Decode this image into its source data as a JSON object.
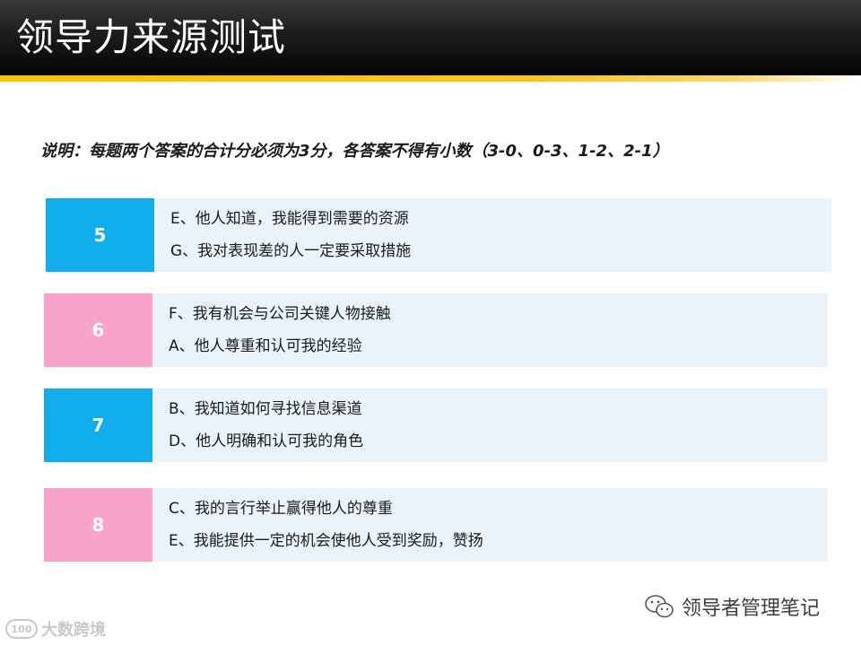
{
  "slide": {
    "title": "领导力来源测试",
    "instruction": "说明：每题两个答案的合计分必须为3分，各答案不得有小数（3-0、0-3、1-2、2-1）"
  },
  "colors": {
    "blue": "#10aeea",
    "pink": "#f9a3cb",
    "accent": "#f6c400",
    "row_background": "#eaf3fa"
  },
  "rows": [
    {
      "number": "5",
      "color": "blue",
      "lines": [
        "E、他人知道，我能得到需要的资源",
        "G、我对表现差的人一定要采取措施"
      ]
    },
    {
      "number": "6",
      "color": "pink",
      "lines": [
        "F、我有机会与公司关键人物接触",
        "A、他人尊重和认可我的经验"
      ]
    },
    {
      "number": "7",
      "color": "blue",
      "lines": [
        "B、我知道如何寻找信息渠道",
        "D、他人明确和认可我的角色"
      ]
    },
    {
      "number": "8",
      "color": "pink",
      "lines": [
        "C、我的言行举止赢得他人的尊重",
        "E、我能提供一定的机会使他人受到奖励，赞扬"
      ]
    }
  ],
  "watermarks": {
    "left_logo": "100",
    "left_text": "大数跨境",
    "right_icon": "wechat-icon",
    "right_text": "领导者管理笔记"
  }
}
